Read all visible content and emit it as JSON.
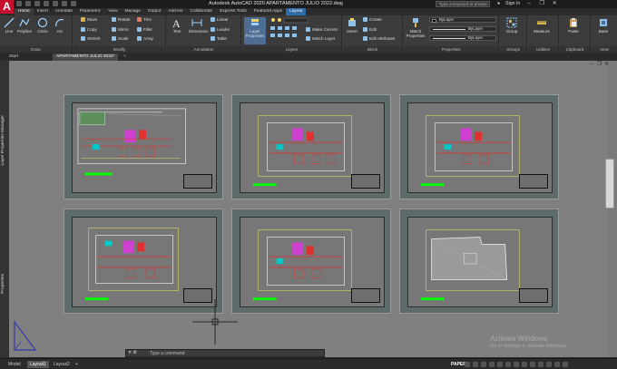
{
  "app": {
    "logo": "A",
    "title": "Autodesk AutoCAD 2020   APARTAMENTO JULIO 2022.dwg",
    "search_placeholder": "Type a keyword or phrase",
    "sign_in": "Sign In"
  },
  "ribbon_tabs": [
    "Home",
    "Insert",
    "Annotate",
    "Parametric",
    "View",
    "Manage",
    "Output",
    "Add-ins",
    "Collaborate",
    "Express Tools",
    "Featured Apps",
    "Layout"
  ],
  "ribbon": {
    "draw": {
      "title": "Draw",
      "tools": [
        "Line",
        "Polyline",
        "Circle",
        "Arc"
      ]
    },
    "modify": {
      "title": "Modify",
      "tools": [
        "Move",
        "Rotate",
        "Trim",
        "Copy",
        "Mirror",
        "Fillet",
        "Stretch",
        "Scale",
        "Array"
      ]
    },
    "annotation": {
      "title": "Annotation",
      "tools": [
        "Text",
        "Dimension",
        "Linear",
        "Leader",
        "Table"
      ]
    },
    "layers": {
      "title": "Layers",
      "layer_properties": "Layer Properties",
      "make_current": "Make Current",
      "match_layer": "Match Layer"
    },
    "block": {
      "title": "Block",
      "insert": "Insert",
      "create": "Create",
      "edit": "Edit",
      "edit_attributes": "Edit Attributes"
    },
    "properties": {
      "title": "Properties",
      "match": "Match Properties",
      "color": "ByLayer",
      "linetype": "ByLayer",
      "lineweight": "ByLayer"
    },
    "groups": {
      "title": "Groups",
      "group": "Group"
    },
    "utilities": {
      "title": "Utilities",
      "measure": "Measure"
    },
    "clipboard": {
      "title": "Clipboard",
      "paste": "Paste"
    },
    "view": {
      "title": "View",
      "base": "Base"
    }
  },
  "file_tabs": {
    "start": "Start",
    "document": "APARTAMENTO JULIO 2022*",
    "add": "+"
  },
  "side_palettes": [
    "Layer Properties Manager",
    "Properties"
  ],
  "command_line": {
    "close": "✕ ⚙",
    "placeholder": "Type a command"
  },
  "watermark": {
    "line1": "Activate Windows",
    "line2": "Go to Settings to activate Windows."
  },
  "status_bar": {
    "model": "Model",
    "layout1": "Layout1",
    "layout2": "Layout2",
    "add": "+",
    "paper": "PAPER"
  },
  "colors": {
    "accent": "#2f6ba8",
    "canvas": "#808080",
    "viewport_title": "#00ff00",
    "plan_red": "#e03030",
    "plan_magenta": "#d040d0"
  }
}
